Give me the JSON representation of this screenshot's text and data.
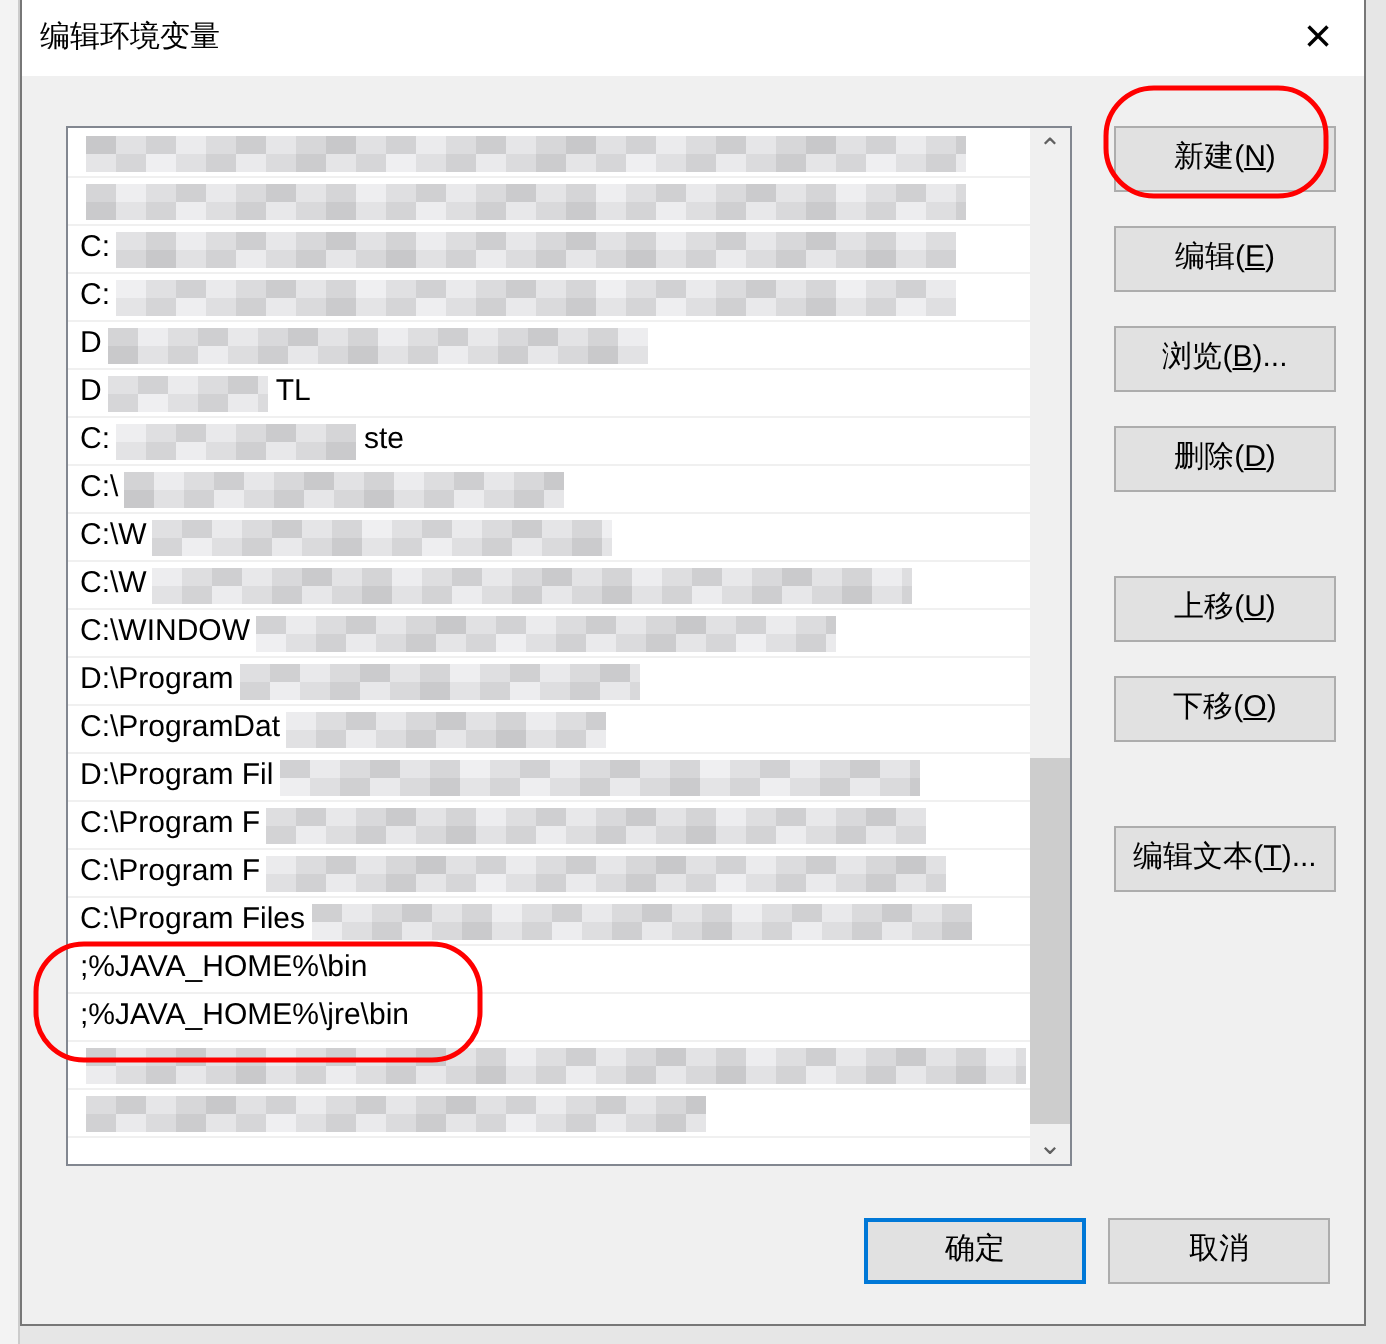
{
  "window": {
    "title": "编辑环境变量",
    "close": "×"
  },
  "list": {
    "rows": [
      {
        "text": ""
      },
      {
        "text": ""
      },
      {
        "text": "C:"
      },
      {
        "text": "C:"
      },
      {
        "text": "D"
      },
      {
        "text": "D",
        "tail": "TL"
      },
      {
        "text": "C:",
        "tail": "ste"
      },
      {
        "text": "C:\\"
      },
      {
        "text": "C:\\W"
      },
      {
        "text": "C:\\W"
      },
      {
        "text": "C:\\WINDOW"
      },
      {
        "text": "D:\\Program"
      },
      {
        "text": "C:\\ProgramDat"
      },
      {
        "text": "D:\\Program Fil"
      },
      {
        "text": "C:\\Program F"
      },
      {
        "text": "C:\\Program F"
      },
      {
        "text": "C:\\Program Files"
      },
      {
        "text": ";%JAVA_HOME%\\bin"
      },
      {
        "text": ";%JAVA_HOME%\\jre\\bin"
      },
      {
        "text": ""
      },
      {
        "text": ""
      }
    ],
    "scroll_up": "⌃",
    "scroll_down": "⌄"
  },
  "side_buttons": [
    {
      "before": "新建(",
      "key": "N",
      "after": ")"
    },
    {
      "before": "编辑(",
      "key": "E",
      "after": ")"
    },
    {
      "before": "浏览(",
      "key": "B",
      "after": ")..."
    },
    {
      "before": "删除(",
      "key": "D",
      "after": ")"
    },
    {
      "before": "上移(",
      "key": "U",
      "after": ")"
    },
    {
      "before": "下移(",
      "key": "O",
      "after": ")"
    },
    {
      "before": "编辑文本(",
      "key": "T",
      "after": ")..."
    }
  ],
  "footer_buttons": [
    {
      "label": "确定",
      "default": true
    },
    {
      "label": "取消",
      "default": false
    }
  ]
}
